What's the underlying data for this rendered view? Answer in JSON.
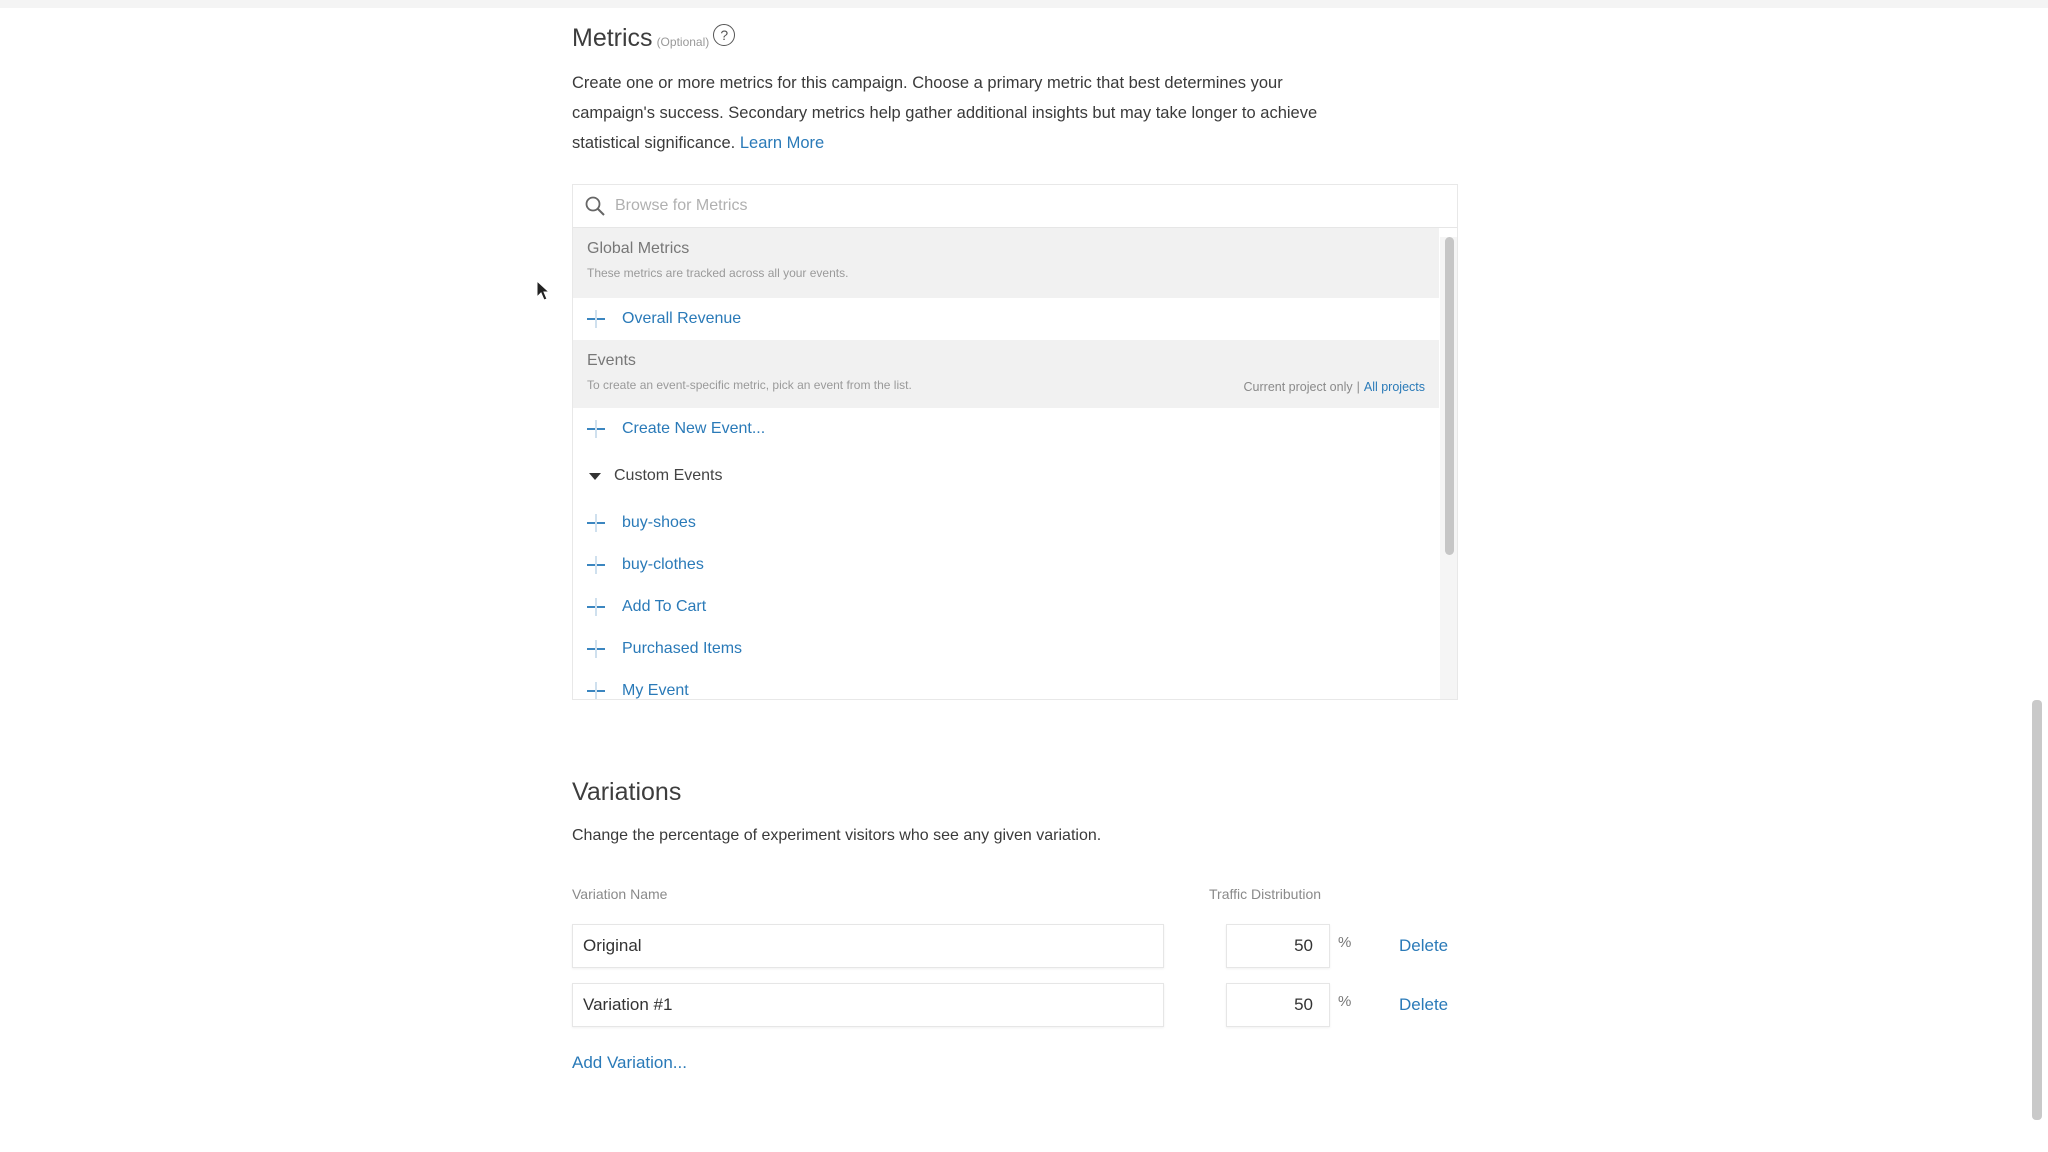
{
  "metrics": {
    "title": "Metrics",
    "optional": "(Optional)",
    "help_glyph": "?",
    "description_lines": [
      "Create one or more metrics for this campaign. Choose a primary metric that best determines your",
      "campaign's success. Secondary metrics help gather additional insights but may take longer to achieve",
      "statistical significance."
    ],
    "learn_more": "Learn More",
    "search_placeholder": "Browse for Metrics",
    "global": {
      "title": "Global Metrics",
      "subtitle": "These metrics are tracked across all your events.",
      "items": [
        "Overall Revenue"
      ]
    },
    "events": {
      "title": "Events",
      "subtitle": "To create an event-specific metric, pick an event from the list.",
      "scope_current": "Current project only",
      "scope_sep": "|",
      "scope_all": "All projects",
      "create_label": "Create New Event..."
    },
    "custom_events": {
      "title": "Custom Events",
      "items": [
        "buy-shoes",
        "buy-clothes",
        "Add To Cart",
        "Purchased Items",
        "My Event"
      ]
    }
  },
  "variations": {
    "title": "Variations",
    "description": "Change the percentage of experiment visitors who see any given variation.",
    "col_name": "Variation Name",
    "col_traffic": "Traffic Distribution",
    "rows": [
      {
        "name": "Original",
        "percent": "50",
        "unit": "%",
        "delete": "Delete"
      },
      {
        "name": "Variation #1",
        "percent": "50",
        "unit": "%",
        "delete": "Delete"
      }
    ],
    "add_label": "Add Variation..."
  }
}
